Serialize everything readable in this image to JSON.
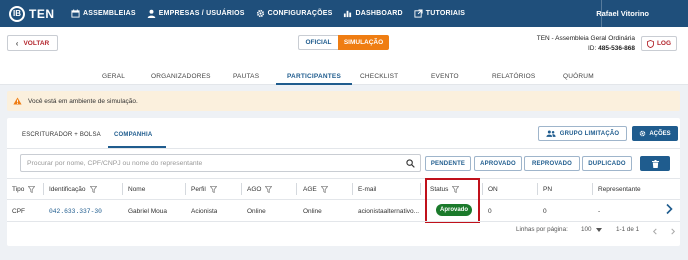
{
  "app": {
    "logo_mark": "IB",
    "name": "TEN"
  },
  "nav": {
    "items": [
      {
        "label": "ASSEMBLEIAS",
        "icon": "calendar-icon"
      },
      {
        "label": "EMPRESAS / USUÁRIOS",
        "icon": "user-icon"
      },
      {
        "label": "CONFIGURAÇÕES",
        "icon": "gear-icon"
      },
      {
        "label": "DASHBOARD",
        "icon": "bar-chart-icon"
      },
      {
        "label": "TUTORIAIS",
        "icon": "external-link-icon"
      }
    ],
    "user": "Rafael Vitorino"
  },
  "header": {
    "back_label": "VOLTAR",
    "mode_official": "OFICIAL",
    "mode_simulation": "SIMULAÇÃO",
    "meeting_title": "TEN - Assembleia Geral Ordinária",
    "meeting_id_label": "ID:",
    "meeting_id": "485-536-868",
    "log_label": "LOG"
  },
  "tabs": [
    "GERAL",
    "ORGANIZADORES",
    "PAUTAS",
    "PARTICIPANTES",
    "CHECKLIST",
    "EVENTO",
    "RELATÓRIOS",
    "QUÓRUM"
  ],
  "active_tab": "PARTICIPANTES",
  "alert": {
    "text": "Você está em ambiente de simulação."
  },
  "panel": {
    "subtabs": [
      "ESCRITURADOR + BOLSA",
      "COMPANHIA"
    ],
    "active_subtab": "COMPANHIA",
    "group_button": "GRUPO LIMITAÇÃO",
    "actions_button": "AÇÕES",
    "search_placeholder": "Procurar por nome, CPF/CNPJ ou nome do representante",
    "filters": [
      "PENDENTE",
      "APROVADO",
      "REPROVADO",
      "DUPLICADO"
    ],
    "columns": [
      "Tipo",
      "Identificação",
      "Nome",
      "Perfil",
      "AGO",
      "AGE",
      "E-mail",
      "Status",
      "ON",
      "PN",
      "Representante"
    ],
    "rows": [
      {
        "tipo": "CPF",
        "identificacao": "042.633.337-30",
        "nome": "Gabriel Moua",
        "perfil": "Acionista",
        "ago": "Online",
        "age": "Online",
        "email": "acionistaalternativo...",
        "status": "Aprovado",
        "on": "0",
        "pn": "0",
        "representante": "-"
      }
    ],
    "pager": {
      "rows_label": "Linhas por página:",
      "rows_value": "100",
      "range": "1-1 de 1"
    }
  },
  "colors": {
    "brand": "#1f4f7b",
    "accent": "#ef7d12",
    "approved": "#1b7a2b",
    "highlight": "#c0111b",
    "alert_bg": "#fbf0dd"
  }
}
